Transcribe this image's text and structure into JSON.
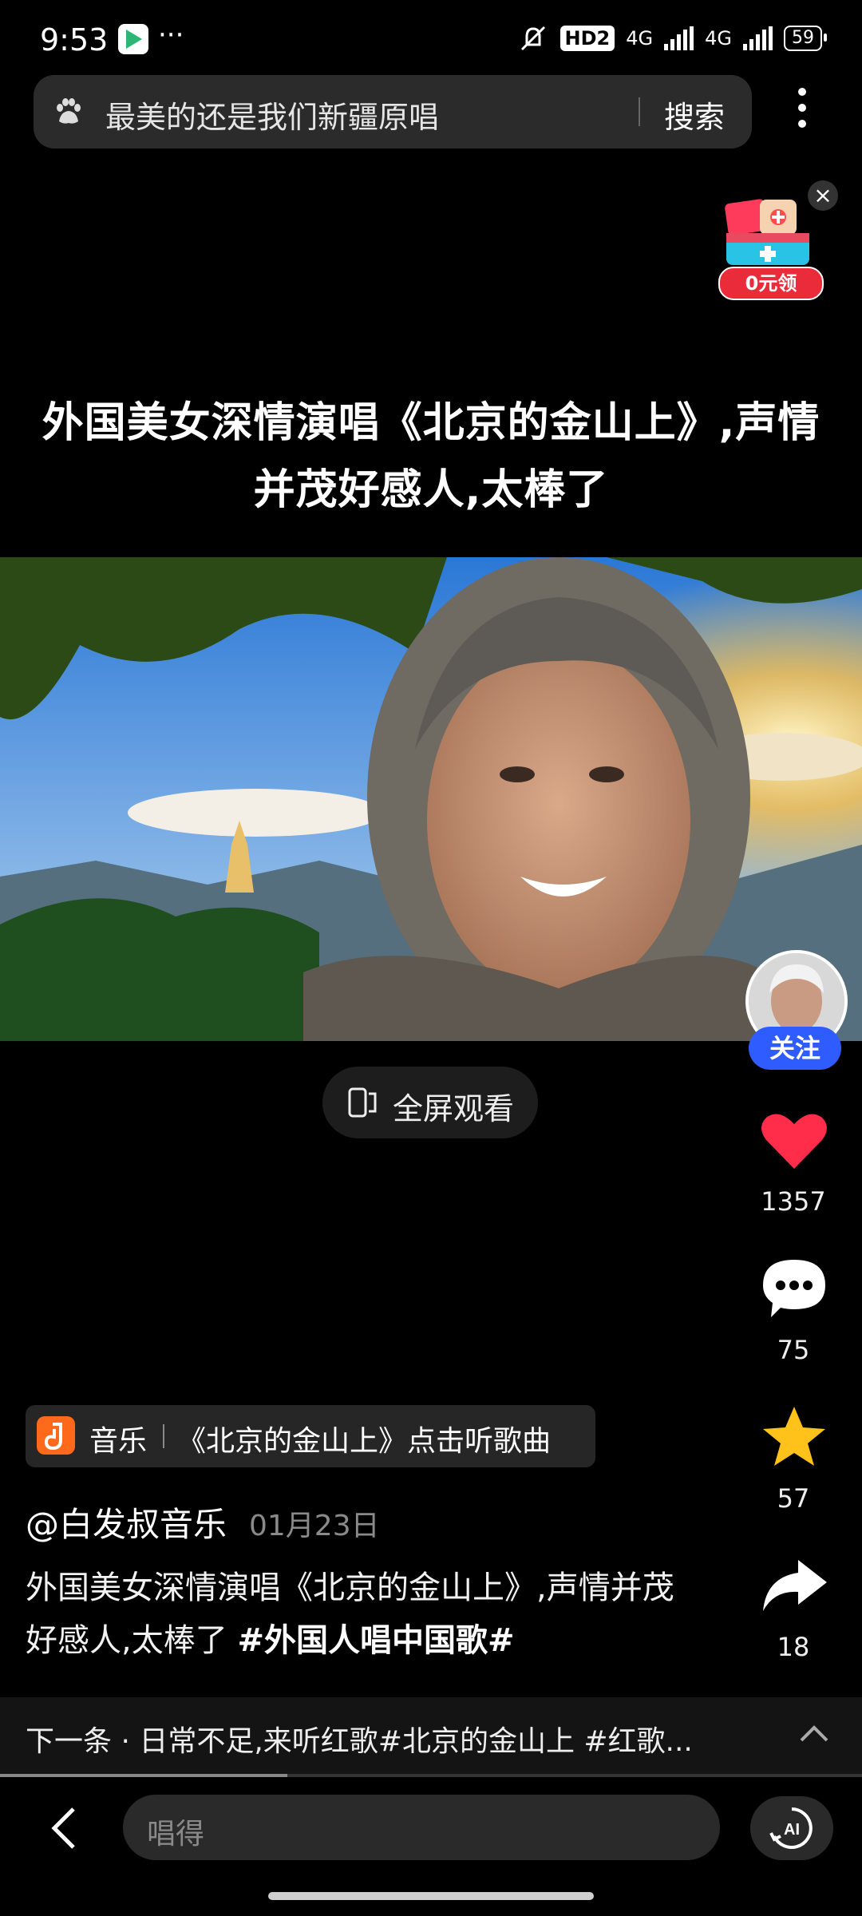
{
  "status_bar": {
    "time": "9:53",
    "more": "···",
    "hd": "HD2",
    "net1": "4G",
    "net2": "4G",
    "battery": "59"
  },
  "search": {
    "query": "最美的还是我们新疆原唱",
    "button": "搜索"
  },
  "promo": {
    "label": "0元领"
  },
  "headline": "外国美女深情演唱《北京的金山上》,声情并茂好感人,太棒了",
  "video": {
    "caption": ""
  },
  "fullscreen_label": "全屏观看",
  "follow_label": "关注",
  "stats": {
    "likes": "1357",
    "comments": "75",
    "favorites": "57",
    "shares": "18"
  },
  "music": {
    "tag": "音乐",
    "song": "《北京的金山上》点击听歌曲"
  },
  "author": {
    "name": "@白发叔音乐",
    "date": "01月23日"
  },
  "description": {
    "text": "外国美女深情演唱《北京的金山上》,声情并茂好感人,太棒了 ",
    "hashtag": "#外国人唱中国歌#"
  },
  "next": {
    "text": "下一条 · 日常不足,来听红歌#北京的金山上 #红歌..."
  },
  "comment": {
    "placeholder": "唱得"
  },
  "colors": {
    "accent_like": "#ff2d4a",
    "follow": "#2f5cff",
    "star": "#ffc21a",
    "music": "#ff6a1a"
  },
  "icons": [
    "paw-icon",
    "kebab-menu-icon",
    "close-icon",
    "gift-icon",
    "fullscreen-icon",
    "heart-icon",
    "comment-icon",
    "star-icon",
    "share-icon",
    "back-icon",
    "ai-icon"
  ]
}
